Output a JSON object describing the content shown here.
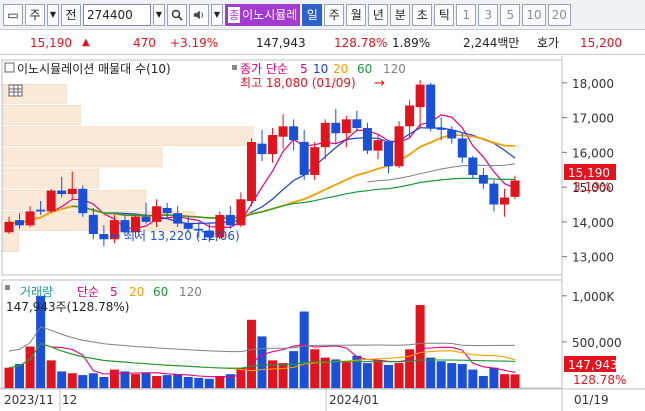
{
  "toolbar": {
    "type_label": "주",
    "jeon_label": "전",
    "code": "274400",
    "name_tag": "종",
    "name": "이노시뮬레",
    "periods": [
      "일",
      "주",
      "월",
      "년",
      "분",
      "초",
      "틱"
    ],
    "numbers": [
      "1",
      "3",
      "5",
      "10",
      "20"
    ]
  },
  "pricebar": {
    "price": "15,190",
    "change": "470",
    "change_pct": "+3.19%",
    "volume": "147,943",
    "vol_ratio": "128.78%",
    "turnover": "1.89%",
    "amount": "2,244백만",
    "hoga_label": "호가",
    "hoga_value": "15,200"
  },
  "price_panel": {
    "title": "이노시뮬레이션 매물대 수(10)",
    "ma_label_prefix": "종가 단순",
    "ma_periods": [
      "5",
      "10",
      "20",
      "60",
      "120"
    ],
    "ma_colors": [
      "#e6007e",
      "#1a3fd6",
      "#f0a000",
      "#1a9a3a",
      "#808080"
    ],
    "high_annotation": "최고 18,080 (01/09)",
    "low_annotation": "최저 13,220 (12/06)",
    "last_price_tag": "15,190",
    "last_pct_tag": "3.19%"
  },
  "volume_panel": {
    "title": "거래량",
    "ma_label_prefix": "단순",
    "ma_periods": [
      "5",
      "20",
      "60",
      "120"
    ],
    "last_volume_label": "147,943주(128.78%)",
    "last_volume_tag": "147,943",
    "last_pct_tag": "128.78%"
  },
  "x_axis": {
    "labels": [
      "2023/11",
      "12",
      "2024/01"
    ],
    "right_label": "01/19"
  },
  "colors": {
    "up": "#e1141e",
    "down": "#1a4fd8",
    "accent": "#a23bd0"
  },
  "chart_data": {
    "type": "candlestick",
    "y_axis_price": {
      "ticks": [
        13000,
        14000,
        15000,
        16000,
        17000,
        18000
      ],
      "tick_labels": [
        "13,000",
        "14,000",
        "15,000",
        "16,000",
        "17,000",
        "18,000"
      ],
      "range": [
        12500,
        18600
      ]
    },
    "y_axis_volume": {
      "ticks": [
        500000,
        1000000
      ],
      "tick_labels": [
        "500,000",
        "1,000K"
      ],
      "range": [
        0,
        1150000
      ]
    },
    "candles": [
      {
        "o": 13700,
        "h": 14150,
        "l": 13650,
        "c": 14000
      },
      {
        "o": 14050,
        "h": 14250,
        "l": 13800,
        "c": 13900
      },
      {
        "o": 13900,
        "h": 14450,
        "l": 13850,
        "c": 14300
      },
      {
        "o": 14350,
        "h": 14600,
        "l": 14200,
        "c": 14300
      },
      {
        "o": 14300,
        "h": 14950,
        "l": 14250,
        "c": 14900
      },
      {
        "o": 14900,
        "h": 15300,
        "l": 14700,
        "c": 14800
      },
      {
        "o": 14800,
        "h": 15450,
        "l": 14650,
        "c": 14950
      },
      {
        "o": 14950,
        "h": 15050,
        "l": 14150,
        "c": 14250
      },
      {
        "o": 14200,
        "h": 14400,
        "l": 13500,
        "c": 13650
      },
      {
        "o": 13650,
        "h": 13900,
        "l": 13300,
        "c": 13500
      },
      {
        "o": 13500,
        "h": 14200,
        "l": 13380,
        "c": 14050
      },
      {
        "o": 14050,
        "h": 14200,
        "l": 13600,
        "c": 13700
      },
      {
        "o": 13700,
        "h": 14200,
        "l": 13550,
        "c": 14150
      },
      {
        "o": 14150,
        "h": 14550,
        "l": 13950,
        "c": 14000
      },
      {
        "o": 14000,
        "h": 14650,
        "l": 13850,
        "c": 14450
      },
      {
        "o": 14400,
        "h": 14550,
        "l": 14100,
        "c": 14250
      },
      {
        "o": 14250,
        "h": 14450,
        "l": 13850,
        "c": 13950
      },
      {
        "o": 13950,
        "h": 14150,
        "l": 13700,
        "c": 13800
      },
      {
        "o": 13800,
        "h": 14000,
        "l": 13550,
        "c": 13750
      },
      {
        "o": 13750,
        "h": 13950,
        "l": 13420,
        "c": 13550
      },
      {
        "o": 13550,
        "h": 14300,
        "l": 13500,
        "c": 14200
      },
      {
        "o": 14200,
        "h": 14450,
        "l": 13800,
        "c": 13900
      },
      {
        "o": 13900,
        "h": 14850,
        "l": 13850,
        "c": 14650
      },
      {
        "o": 14600,
        "h": 16400,
        "l": 14450,
        "c": 16300
      },
      {
        "o": 16250,
        "h": 16650,
        "l": 15750,
        "c": 15950
      },
      {
        "o": 15950,
        "h": 16700,
        "l": 15700,
        "c": 16500
      },
      {
        "o": 16450,
        "h": 17100,
        "l": 16100,
        "c": 16750
      },
      {
        "o": 16750,
        "h": 16950,
        "l": 16050,
        "c": 16350
      },
      {
        "o": 16300,
        "h": 16650,
        "l": 15200,
        "c": 15350
      },
      {
        "o": 15350,
        "h": 16300,
        "l": 15200,
        "c": 16150
      },
      {
        "o": 16150,
        "h": 16950,
        "l": 15800,
        "c": 16850
      },
      {
        "o": 16850,
        "h": 17250,
        "l": 16250,
        "c": 16550
      },
      {
        "o": 16550,
        "h": 17050,
        "l": 16150,
        "c": 16950
      },
      {
        "o": 16950,
        "h": 17200,
        "l": 16600,
        "c": 16700
      },
      {
        "o": 16700,
        "h": 16850,
        "l": 15950,
        "c": 16050
      },
      {
        "o": 16050,
        "h": 16500,
        "l": 15800,
        "c": 16350
      },
      {
        "o": 16300,
        "h": 16350,
        "l": 15400,
        "c": 15600
      },
      {
        "o": 15600,
        "h": 16900,
        "l": 15550,
        "c": 16750
      },
      {
        "o": 16750,
        "h": 17500,
        "l": 16400,
        "c": 17350
      },
      {
        "o": 17300,
        "h": 18080,
        "l": 16700,
        "c": 17950
      },
      {
        "o": 17950,
        "h": 18000,
        "l": 16600,
        "c": 16700
      },
      {
        "o": 16700,
        "h": 17000,
        "l": 16350,
        "c": 16650
      },
      {
        "o": 16650,
        "h": 16750,
        "l": 16250,
        "c": 16400
      },
      {
        "o": 16400,
        "h": 16550,
        "l": 15700,
        "c": 15850
      },
      {
        "o": 15850,
        "h": 15900,
        "l": 15250,
        "c": 15350
      },
      {
        "o": 15350,
        "h": 15550,
        "l": 14950,
        "c": 15100
      },
      {
        "o": 15100,
        "h": 15200,
        "l": 14300,
        "c": 14500
      },
      {
        "o": 14500,
        "h": 14950,
        "l": 14150,
        "c": 14700
      },
      {
        "o": 14720,
        "h": 15330,
        "l": 14650,
        "c": 15190
      }
    ],
    "volumes": [
      220000,
      260000,
      450000,
      1000000,
      300000,
      180000,
      160000,
      140000,
      160000,
      120000,
      200000,
      180000,
      150000,
      170000,
      130000,
      140000,
      150000,
      120000,
      110000,
      100000,
      130000,
      150000,
      220000,
      740000,
      560000,
      300000,
      270000,
      400000,
      830000,
      420000,
      330000,
      310000,
      280000,
      350000,
      270000,
      300000,
      250000,
      270000,
      420000,
      900000,
      330000,
      290000,
      270000,
      260000,
      200000,
      130000,
      220000,
      150000,
      147943
    ]
  }
}
